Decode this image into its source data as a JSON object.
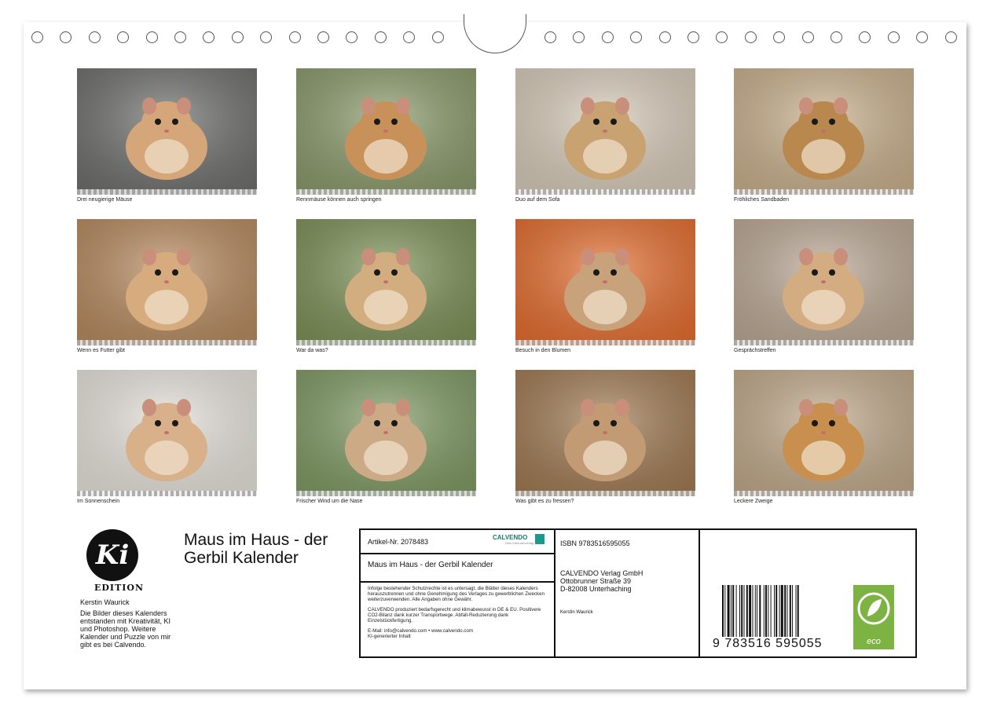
{
  "photos": [
    {
      "caption": "Drei neugierige Mäuse",
      "bg": "#6e6f6d",
      "fg": "#d4a679"
    },
    {
      "caption": "Rennmäuse können auch springen",
      "bg": "#8a9a6a",
      "fg": "#c9915a"
    },
    {
      "caption": "Duo auf dem Sofa",
      "bg": "#d7cbb9",
      "fg": "#c8a270"
    },
    {
      "caption": "Fröhliches Sandbaden",
      "bg": "#c9b08c",
      "fg": "#b9884f"
    },
    {
      "caption": "Wenn es Futter gibt",
      "bg": "#b78a5e",
      "fg": "#d6ac7e"
    },
    {
      "caption": "War da was?",
      "bg": "#7d9157",
      "fg": "#d2ad80"
    },
    {
      "caption": "Besuch in den Blumen",
      "bg": "#e56d2e",
      "fg": "#c8a27b"
    },
    {
      "caption": "Gesprächstreffen",
      "bg": "#bba894",
      "fg": "#d3ac82"
    },
    {
      "caption": "Im Sonnenschein",
      "bg": "#e7e2db",
      "fg": "#d8b08a"
    },
    {
      "caption": "Frischer Wind um die Nase",
      "bg": "#7f9a63",
      "fg": "#ccaa86"
    },
    {
      "caption": "Was gibt es zu fressen?",
      "bg": "#a07a52",
      "fg": "#c29a74"
    },
    {
      "caption": "Leckere Zweige",
      "bg": "#c1a98a",
      "fg": "#c98f4e"
    }
  ],
  "logo": {
    "mark": "Ki",
    "edition": "EDITION"
  },
  "author": {
    "name": "Kerstin Waurick",
    "bio": "Die Bilder dieses Kalenders entstanden mit Kreativität, KI und Photoshop. Weitere Kalender und Puzzle von mir gibt es bei Calvendo."
  },
  "title": "Maus im Haus - der Gerbil Kalender",
  "info": {
    "article": "Artikel-Nr. 2078483",
    "calvendo_logo": "CALVENDO",
    "calvendo_sub": "Dein Kalenderverlag",
    "subtitle": "Maus im Haus - der Gerbil Kalender",
    "legal1": "Infolge bestehender Schutzrechte ist es untersagt, die Blätter dieses Kalenders herauszutrennen und ohne Genehmigung des Verlages zu gewerblichen Zwecken weiterzuverwenden. Alle Angaben ohne Gewähr.",
    "legal2": "CALVENDO produziert bedarfsgerecht und klimabewusst in DE & EU. Positivere CO2-Bilanz dank kurzer Transportwege. Abfall-Reduzierung dank Einzelstückfertigung.",
    "email": "E-Mail: info@calvendo.com • www.calvendo.com",
    "ki_note": "KI-generierter Inhalt",
    "isbn": "ISBN 9783516595055",
    "publisher_name": "CALVENDO Verlag GmbH",
    "publisher_street": "Ottobrunner Straße 39",
    "publisher_city": "D-82008 Unterhaching",
    "author_small": "Kerstin Waurick",
    "barcode_digits": "9 783516 595055",
    "eco": "eco"
  },
  "colors": {
    "accent": "#1a9a8c",
    "eco": "#7cb342"
  }
}
